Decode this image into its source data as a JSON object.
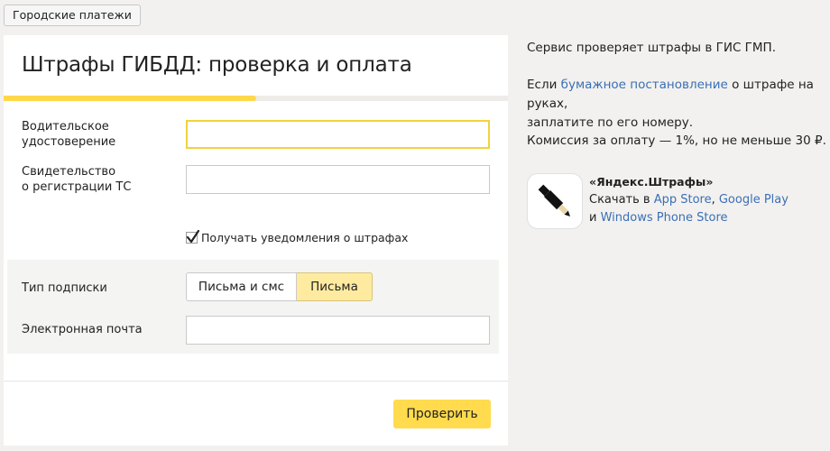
{
  "top_button": {
    "label": "Городские платежи"
  },
  "form": {
    "title": "Штрафы ГИБДД: проверка и оплата",
    "progress": 0.5,
    "license_label_line1": "Водительское",
    "license_label_line2": "удостоверение",
    "license_value": "",
    "registration_label_line1": "Свидетельство",
    "registration_label_line2": "о регистрации ТС",
    "registration_value": "",
    "notify_checkbox": {
      "label": "Получать уведомления о штрафах",
      "checked": true
    },
    "subscription": {
      "label": "Тип подписки",
      "options": [
        "Письма и смс",
        "Письма"
      ],
      "selected": "Письма"
    },
    "email": {
      "label": "Электронная почта",
      "value": ""
    },
    "submit_label": "Проверить"
  },
  "sidebar": {
    "service_text": "Сервис проверяет штрафы в ГИС ГМП.",
    "paper_prefix": "Если ",
    "paper_link": "бумажное постановление",
    "paper_suffix": " о штрафе на руках,",
    "paper_line2": "заплатите по его номеру.",
    "commission": "Комиссия за оплату — 1%, но не меньше 30 ₽.",
    "app": {
      "icon": "pen-icon",
      "name": "«Яндекс.Штрафы»",
      "download_prefix": "Скачать в ",
      "app_store": "App Store",
      "separator": ", ",
      "google_play": "Google Play",
      "and_prefix": "и ",
      "windows_store": "Windows Phone Store"
    }
  },
  "colors": {
    "accent_yellow": "#ffdb4d",
    "selected_segment": "#ffeba0",
    "link": "#3a6fb5",
    "background": "#f2f1ef"
  }
}
